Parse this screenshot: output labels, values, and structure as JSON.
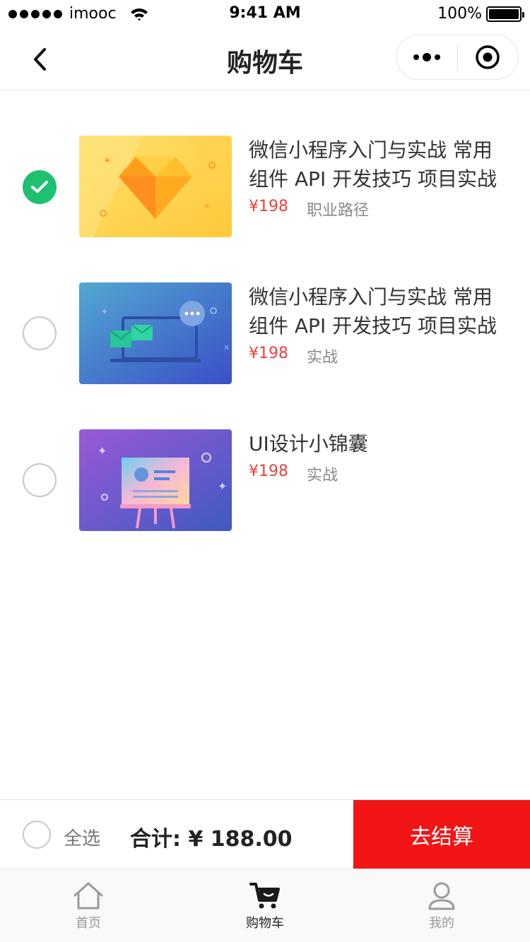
{
  "status_bar": {
    "carrier": "imooc",
    "time": "9:41 AM",
    "battery": "100%"
  },
  "nav": {
    "title": "购物车"
  },
  "colors": {
    "accent_green": "#1fc070",
    "price_red": "#e64340",
    "pay_red": "#f21515"
  },
  "cart": {
    "items": [
      {
        "title": "微信小程序入门与实战 常用组件 API 开发技巧 项目实战",
        "price": "¥198",
        "tag": "职业路径",
        "checked": true,
        "thumb": "sketch-diamond"
      },
      {
        "title": "微信小程序入门与实战 常用组件 API 开发技巧 项目实战",
        "price": "¥198",
        "tag": "实战",
        "checked": false,
        "thumb": "laptop-messages"
      },
      {
        "title": "UI设计小锦囊",
        "price": "¥198",
        "tag": "实战",
        "checked": false,
        "thumb": "easel-board"
      }
    ]
  },
  "checkout": {
    "select_all_label": "全选",
    "total_label": "合计: ¥ 188.00",
    "pay_label": "去结算"
  },
  "tabbar": {
    "tabs": [
      {
        "label": "首页",
        "icon": "home-icon",
        "active": false
      },
      {
        "label": "购物车",
        "icon": "cart-icon",
        "active": true
      },
      {
        "label": "我的",
        "icon": "user-icon",
        "active": false
      }
    ]
  }
}
